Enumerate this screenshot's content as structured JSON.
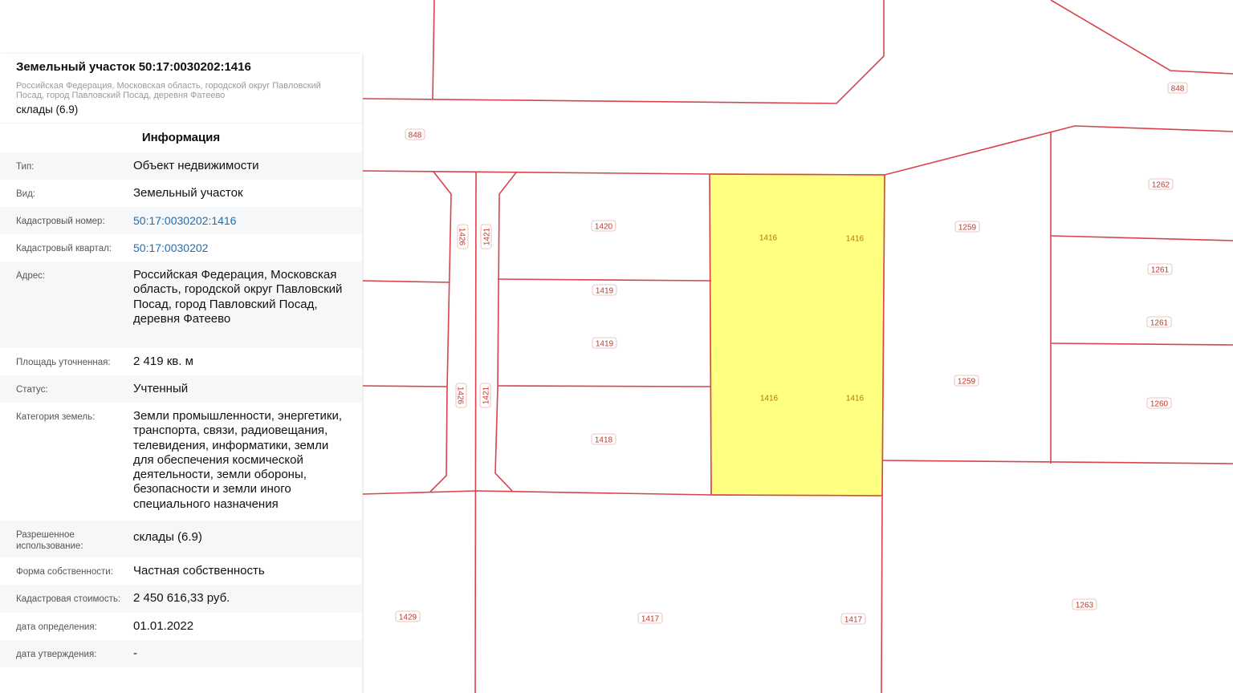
{
  "panel": {
    "title": "Земельный участок 50:17:0030202:1416",
    "address_short": "Российская Федерация, Московская область, городской округ Павловский Посад, город Павловский Посад, деревня Фатеево",
    "use_short": "склады (6.9)",
    "section": "Информация",
    "rows": [
      {
        "key": "Тип:",
        "value": "Объект недвижимости"
      },
      {
        "key": "Вид:",
        "value": "Земельный участок"
      },
      {
        "key": "Кадастровый номер:",
        "value": "50:17:0030202:1416"
      },
      {
        "key": "Кадастровый квартал:",
        "value": "50:17:0030202"
      },
      {
        "key": "Адрес:",
        "value": "Российская Федерация, Московская область, городской округ Павловский Посад, город Павловский Посад, деревня Фатеево"
      },
      {
        "key": "Площадь уточненная:",
        "value": "2 419 кв. м"
      },
      {
        "key": "Статус:",
        "value": "Учтенный"
      },
      {
        "key": "Категория земель:",
        "value": "Земли промышленности, энергетики, транспорта, связи, радиовещания, телевидения, информатики, земли для обеспечения космической деятельности, земли обороны, безопасности и земли иного специального назначения"
      },
      {
        "key": "Разрешенное использование:",
        "value": "склады (6.9)"
      },
      {
        "key": "Форма собственности:",
        "value": "Частная собственность"
      },
      {
        "key": "Кадастровая стоимость:",
        "value": "2 450 616,33 руб."
      },
      {
        "key": "дата определения:",
        "value": "01.01.2022"
      },
      {
        "key": "дата утверждения:",
        "value": "-"
      }
    ]
  },
  "map": {
    "colors": {
      "boundary": "#d9434c",
      "selected_fill": "#ffff80",
      "selected_stroke": "#e8b83a"
    },
    "labels": [
      {
        "id": "848a",
        "text": "848"
      },
      {
        "id": "848b",
        "text": "848"
      },
      {
        "id": "1262",
        "text": "1262"
      },
      {
        "id": "1420",
        "text": "1420"
      },
      {
        "id": "1259a",
        "text": "1259"
      },
      {
        "id": "1261a",
        "text": "1261"
      },
      {
        "id": "1419a",
        "text": "1419"
      },
      {
        "id": "1261b",
        "text": "1261"
      },
      {
        "id": "1419b",
        "text": "1419"
      },
      {
        "id": "1259b",
        "text": "1259"
      },
      {
        "id": "1260",
        "text": "1260"
      },
      {
        "id": "1418",
        "text": "1418"
      },
      {
        "id": "1263",
        "text": "1263"
      },
      {
        "id": "1429",
        "text": "1429"
      },
      {
        "id": "1417a",
        "text": "1417"
      },
      {
        "id": "1417b",
        "text": "1417"
      },
      {
        "id": "1426a",
        "text": "1426"
      },
      {
        "id": "1421a",
        "text": "1421"
      },
      {
        "id": "1426b",
        "text": "1426"
      },
      {
        "id": "1421b",
        "text": "1421"
      },
      {
        "id": "1416a",
        "text": "1416"
      },
      {
        "id": "1416b",
        "text": "1416"
      },
      {
        "id": "1416c",
        "text": "1416"
      },
      {
        "id": "1416d",
        "text": "1416"
      }
    ]
  }
}
